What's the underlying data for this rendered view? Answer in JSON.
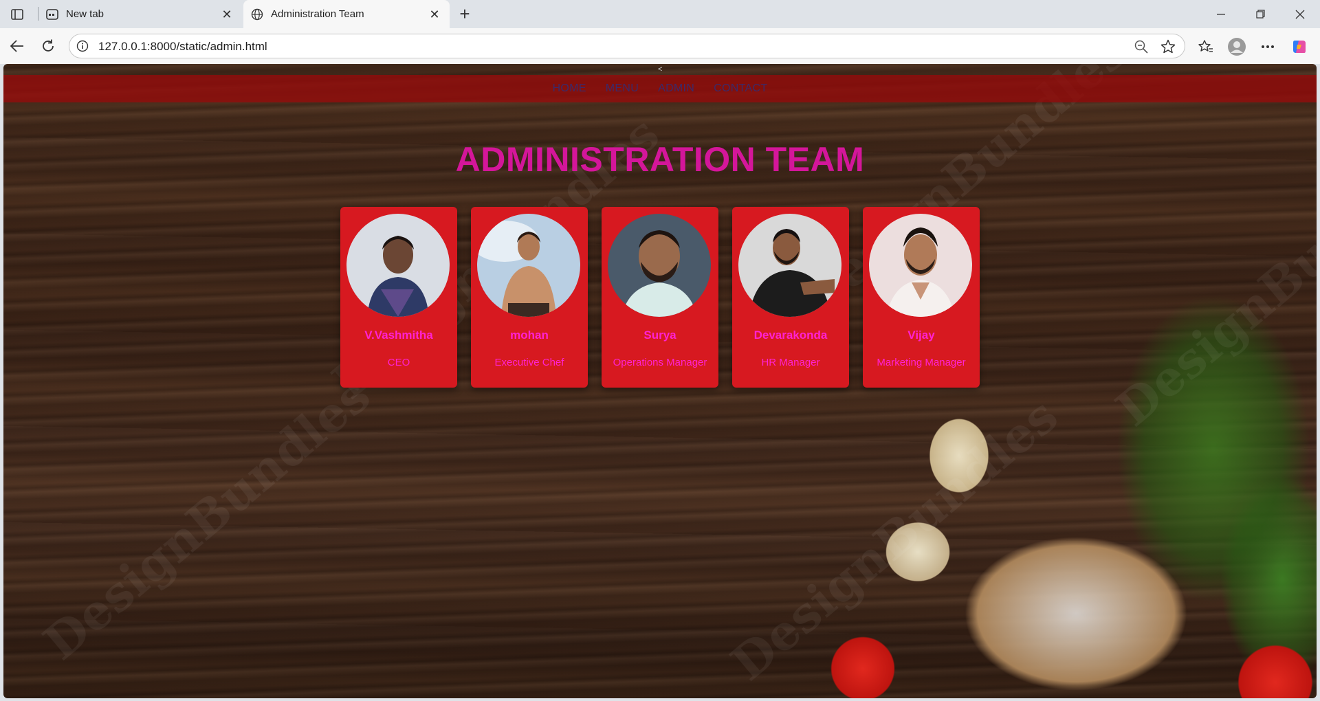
{
  "browser": {
    "tabs": [
      {
        "title": "New tab",
        "active": false
      },
      {
        "title": "Administration Team",
        "active": true
      }
    ],
    "url": "127.0.0.1:8000/static/admin.html"
  },
  "page": {
    "nav": {
      "caret": "<",
      "links": [
        "HOME",
        "MENU",
        "ADMIN",
        "CONTACT"
      ]
    },
    "title": "ADMINISTRATION TEAM",
    "watermark": "DesignBundles",
    "team": [
      {
        "name": "V.Vashmitha",
        "role": "CEO"
      },
      {
        "name": "mohan",
        "role": "Executive Chef"
      },
      {
        "name": "Surya",
        "role": "Operations Manager"
      },
      {
        "name": "Devarakonda",
        "role": "HR Manager"
      },
      {
        "name": "Vijay",
        "role": "Marketing Manager"
      }
    ]
  },
  "colors": {
    "nav_bg": "#960a0a",
    "nav_link": "#3b2a6a",
    "title": "#d4169a",
    "card_bg": "#d71920",
    "card_text": "#ff22d2"
  }
}
